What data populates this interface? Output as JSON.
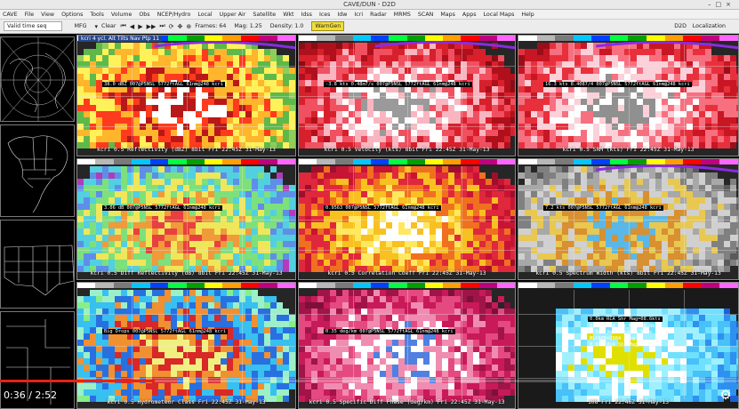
{
  "window": {
    "title": "CAVE/DUN - D2D",
    "controls": [
      "–",
      "□",
      "×"
    ]
  },
  "menu": [
    "CAVE",
    "File",
    "View",
    "Options",
    "Tools",
    "Volume",
    "Obs",
    "NCEP/Hydro",
    "Local",
    "Upper Air",
    "Satellite",
    "Wkt",
    "Idss",
    "Ices",
    "Idw",
    "Icri",
    "Radar",
    "MRMS",
    "SCAN",
    "Maps",
    "Apps",
    "Local Maps",
    "Help"
  ],
  "toolbar": {
    "time_select": "Valid time seq",
    "mode": "MFG",
    "clear": "Clear",
    "frames": "Frames: 64",
    "mag": "Mag: 1.25",
    "density": "Density: 1.0",
    "warngen": "WarnGen",
    "d2d": "D2D",
    "localization": "Localization"
  },
  "tab": "kcri 4 ycl. Alt Tilts Nav Ptp 11",
  "panes": [
    {
      "label": "kcri 0.5  Reflectivity (dBZ) 8bit  Fri 22:45Z 31-May-13",
      "readout": "38.0 dBZ 007@P5NSL 5772ftAGL 61nm@248 kcri"
    },
    {
      "label": "kcri 0.5  Velocity (kts) 8bit  Fri 22:45Z 31-May-13",
      "readout": "-3.8 kts 0.48m7/s 007@P5NSL 5772ftAGL 61nm@248 kcri"
    },
    {
      "label": "kcri 0.5  SRM (kts)  Fri 22:45Z 31-May-13",
      "readout": "16.3 kts 8.4087/4 007@P5NSL 5772ftAGL 61nm@248 kcri"
    },
    {
      "label": "kcri 0.5  Diff Reflectivity (dB) 8bit  Fri 22:45Z 31-May-13",
      "readout": "3.06 dB 007@P5NSL 5772ftAGL 61nm@248 kcri"
    },
    {
      "label": "kcri 0.5  Correlation Coeff  Fri 22:45Z 31-May-13",
      "readout": "0.9563 007@P5NSL 5772ftAGL 61nm@248 kcri"
    },
    {
      "label": "kcri 0.5  Spectrum Width (kts) 8bit  Fri 22:45Z 31-May-13",
      "readout": "7.2 kts 007@P5NSL 5772ftAGL 61nm@248 kcri"
    },
    {
      "label": "kcri 0.5  Hydrometeor Class  Fri 22:45Z 31-May-13",
      "readout": "Big Drops 007@P5NSL 5772ftAGL 61nm@248 kcri"
    },
    {
      "label": "kcri 0.5  Specific Diff Phase (deg/km)  Fri 22:45Z 31-May-13",
      "readout": "0.35 deg/km 007@P5NSL 5772ftAGL 61nm@248 kcri"
    },
    {
      "label": "108 Fri 22:46Z 31-May-13",
      "readout": "0.0km RCA Shr Mag=08.6kts"
    }
  ],
  "legend_lines": [
    "0.5km RCA Shr Mag=08.6kts",
    "0.5km Velocity=04.5kts",
    "MLCAPE=2984 J/kg",
    "0.8km RCA Shr Mag"
  ],
  "swatch_colors": [
    "#ffffff",
    "#b8b8b8",
    "#7a7a7a",
    "#00c8ff",
    "#0040ff",
    "#00ff40",
    "#00a000",
    "#ffff00",
    "#ffa000",
    "#ff0000",
    "#c00080",
    "#ff66ff"
  ],
  "video": {
    "time": "0:36 / 2:52",
    "progress_fraction": 0.209
  },
  "colors": {
    "accent": "#e62117",
    "warngen": "#f1dd3b",
    "tab": "#26468c"
  }
}
